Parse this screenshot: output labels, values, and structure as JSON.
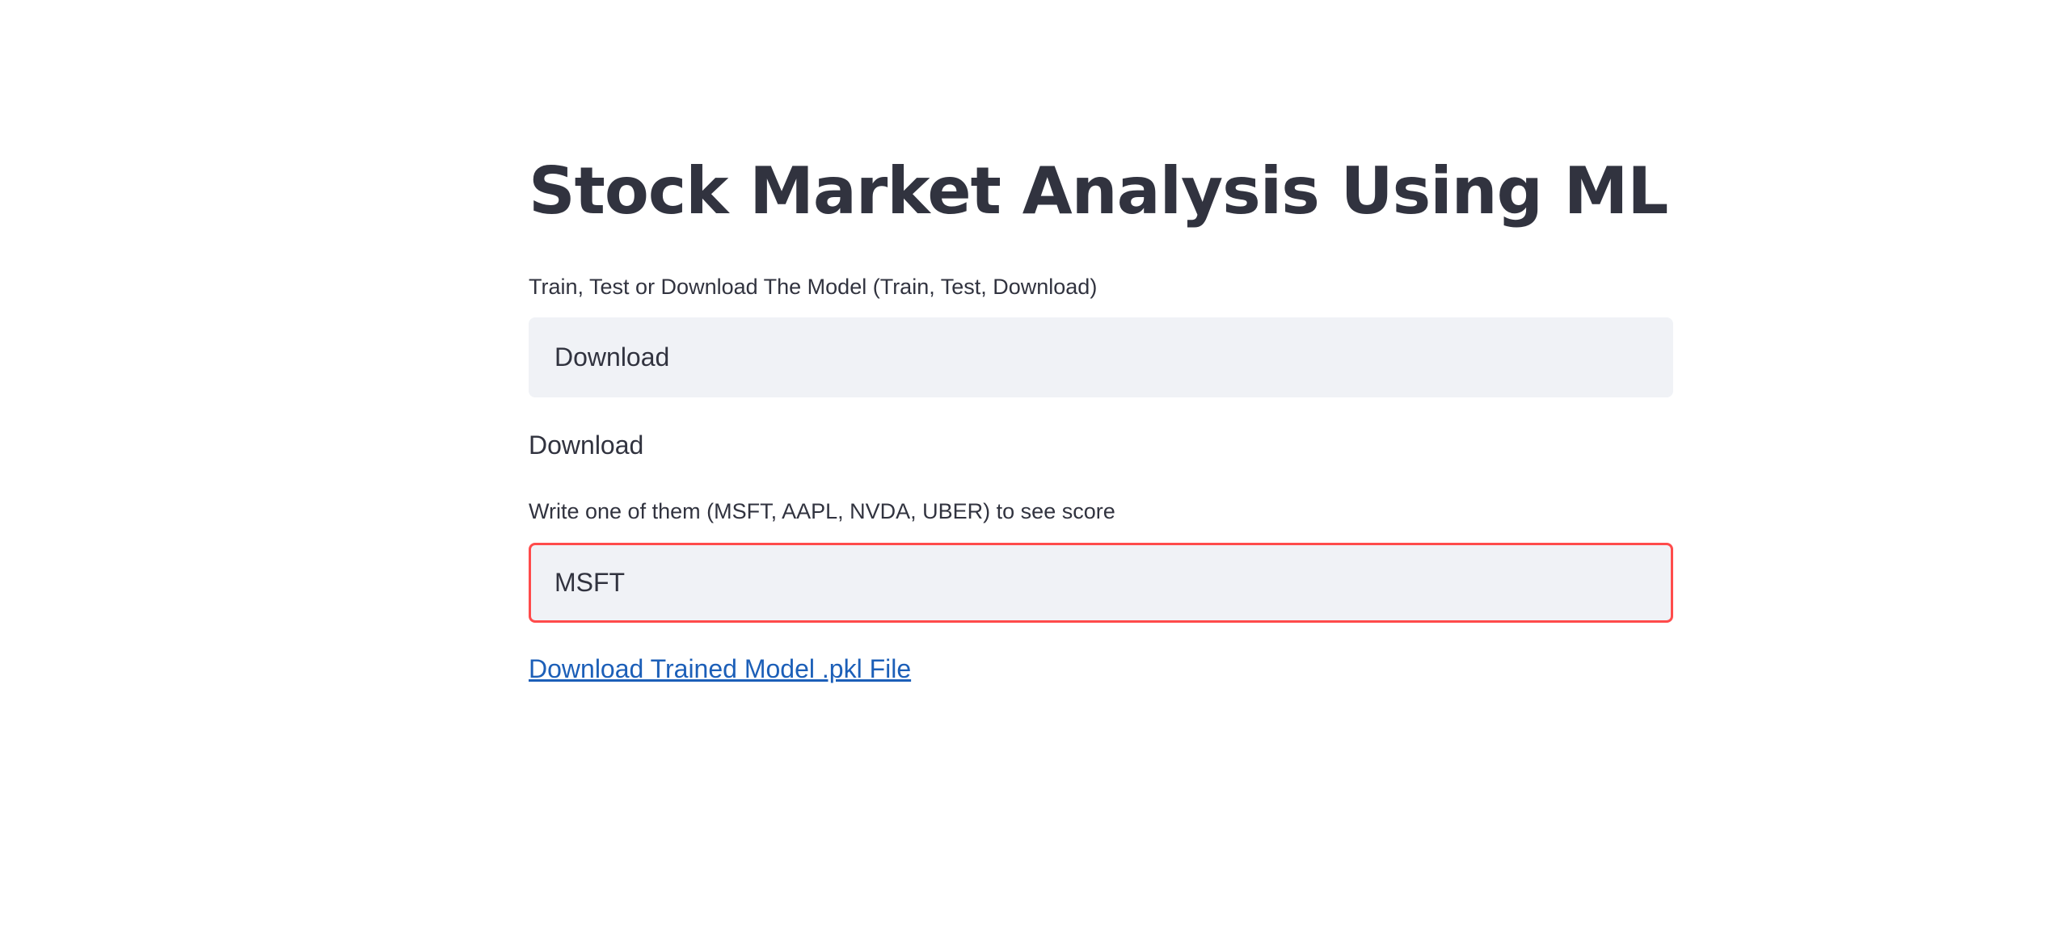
{
  "header": {
    "title": "Stock Market Analysis Using ML"
  },
  "mode_input": {
    "label": "Train, Test or Download The Model (Train, Test, Download)",
    "value": "Download"
  },
  "mode_echo": "Download",
  "ticker_input": {
    "label": "Write one of them (MSFT, AAPL, NVDA, UBER) to see score",
    "value": "MSFT",
    "focus_border_color": "#ff4b4b"
  },
  "download_link": {
    "label": "Download Trained Model .pkl File",
    "color": "#1c5fb8"
  },
  "theme": {
    "text_color": "#31333f",
    "input_background": "#f0f2f6"
  }
}
